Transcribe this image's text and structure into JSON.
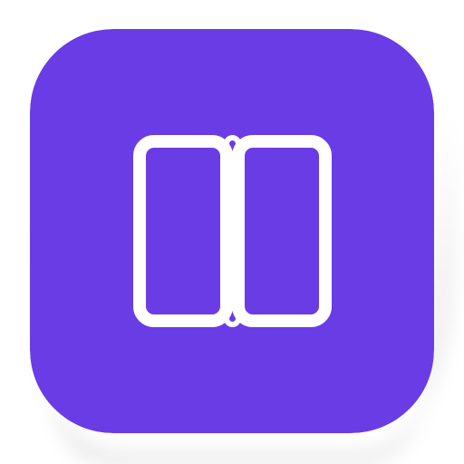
{
  "icon": {
    "name": "dual-screen-foldable-device-icon",
    "background_color": "#6a3ce6",
    "glyph_color": "#ffffff",
    "shadow_color": "#d9d9d9"
  }
}
